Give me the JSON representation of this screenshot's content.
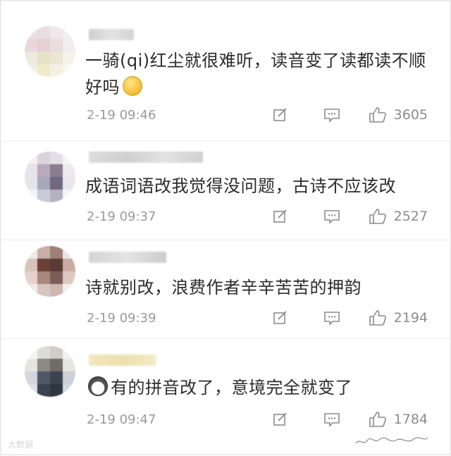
{
  "comments": [
    {
      "text_before_emoji": "一骑(qi)红尘就很难听，读音变了读都读不顺好吗",
      "emoji": "shy-face-emoji",
      "text_after_emoji": "",
      "time": "2-19 09:46",
      "likes": "3605"
    },
    {
      "text_before_emoji": "成语词语改我觉得没问题，古诗不应该改",
      "emoji": "",
      "text_after_emoji": "",
      "time": "2-19 09:37",
      "likes": "2527"
    },
    {
      "text_before_emoji": "诗就别改，浪费作者辛辛苦苦的押韵",
      "emoji": "",
      "text_after_emoji": "",
      "time": "2-19 09:39",
      "likes": "2194"
    },
    {
      "text_before_emoji": "",
      "emoji": "husky-face-emoji",
      "text_after_emoji": "有的拼音改了，意境完全就变了",
      "time": "2-19 09:47",
      "likes": "1784"
    }
  ],
  "watermark": "大数据",
  "colors": {
    "text": "#2b2b2b",
    "meta": "#9a9a9a",
    "icon": "#8c8c8c",
    "divider": "#ececec"
  }
}
